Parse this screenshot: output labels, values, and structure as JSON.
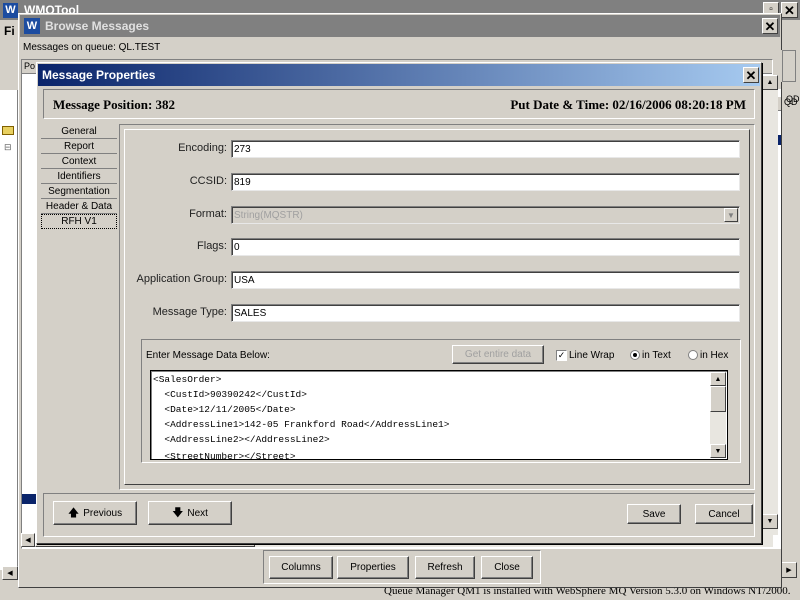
{
  "main_window": {
    "title": "WMQTool",
    "menu_first": "Fi"
  },
  "browse_window": {
    "title": "Browse Messages",
    "queue_label": "Messages on queue: QL.TEST",
    "column_header_partial": "Po",
    "right_header_partial": "QD",
    "buttons": {
      "columns": "Columns",
      "properties": "Properties",
      "refresh": "Refresh",
      "close": "Close"
    }
  },
  "dialog": {
    "title": "Message Properties",
    "position_label": "Message Position: 382",
    "put_datetime": "Put Date & Time: 02/16/2006 08:20:18 PM",
    "tabs": [
      "General",
      "Report",
      "Context",
      "Identifiers",
      "Segmentation",
      "Header & Data",
      "RFH V1"
    ],
    "active_tab_index": 6,
    "fields": {
      "encoding": {
        "label": "Encoding:",
        "value": "273"
      },
      "ccsid": {
        "label": "CCSID:",
        "value": "819"
      },
      "format": {
        "label": "Format:",
        "value": "String(MQSTR)"
      },
      "flags": {
        "label": "Flags:",
        "value": "0"
      },
      "application_group": {
        "label": "Application Group:",
        "value": "USA"
      },
      "message_type": {
        "label": "Message Type:",
        "value": "SALES"
      }
    },
    "data_section": {
      "label": "Enter Message Data Below:",
      "get_entire_data": "Get entire data",
      "line_wrap": "Line Wrap",
      "line_wrap_checked": true,
      "in_text": "in Text",
      "in_hex": "in Hex",
      "selected_mode": "in Text",
      "lines": [
        "<SalesOrder>",
        "  <CustId>90390242</CustId>",
        "  <Date>12/11/2005</Date>",
        "  <AddressLine1>142-05 Frankford Road</AddressLine1>",
        "  <AddressLine2></AddressLine2>",
        "  <StreetNumber></Street>"
      ]
    },
    "buttons": {
      "previous": "Previous",
      "next": "Next",
      "save": "Save",
      "cancel": "Cancel"
    }
  },
  "status_bar": "Queue Manager QM1 is installed with WebSphere MQ Version 5.3.0 on Windows NT/2000.",
  "colors": {
    "active_title_start": "#0a246a",
    "active_title_end": "#a6caf0",
    "inactive_title": "#808080",
    "face": "#d4d0c8"
  }
}
